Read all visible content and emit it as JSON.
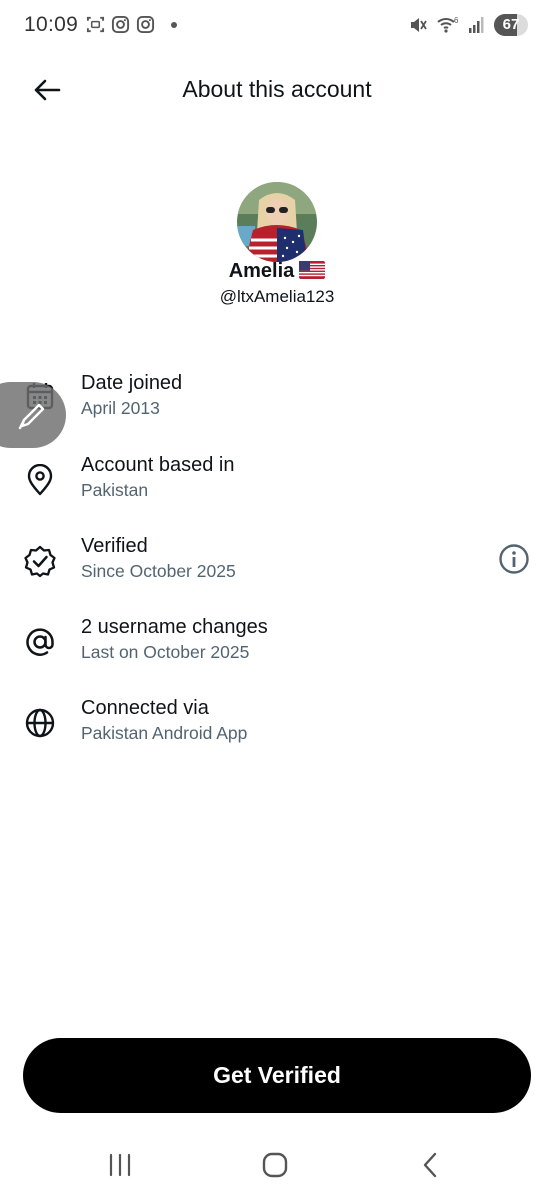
{
  "status_bar": {
    "time": "10:09",
    "battery": "67",
    "left_icons": [
      "screenshot-icon",
      "instagram-icon",
      "instagram-icon",
      "notification-dot-icon"
    ],
    "right_icons": [
      "mute-icon",
      "wifi-icon",
      "signal-icon",
      "battery-icon"
    ]
  },
  "header": {
    "title": "About this account",
    "back_icon": "arrow-left-icon"
  },
  "profile": {
    "name": "Amelia",
    "flag": "🇺🇸",
    "handle": "@ltxAmelia123"
  },
  "info": [
    {
      "icon": "calendar-icon",
      "label": "Date joined",
      "value": "April 2013"
    },
    {
      "icon": "location-pin-icon",
      "label": "Account based in",
      "value": "Pakistan"
    },
    {
      "icon": "verified-badge-icon",
      "label": "Verified",
      "value": "Since October 2025",
      "action_icon": "info-icon"
    },
    {
      "icon": "at-sign-icon",
      "label": "2 username changes",
      "value": "Last on October 2025"
    },
    {
      "icon": "globe-icon",
      "label": "Connected via",
      "value": "Pakistan Android App"
    }
  ],
  "cta": {
    "label": "Get Verified"
  },
  "nav": {
    "icons": [
      "recent-apps-icon",
      "home-icon",
      "back-icon"
    ]
  },
  "colors": {
    "text_primary": "#0f1419",
    "text_secondary": "#536471",
    "cta_bg": "#000000",
    "cta_text": "#ffffff"
  }
}
